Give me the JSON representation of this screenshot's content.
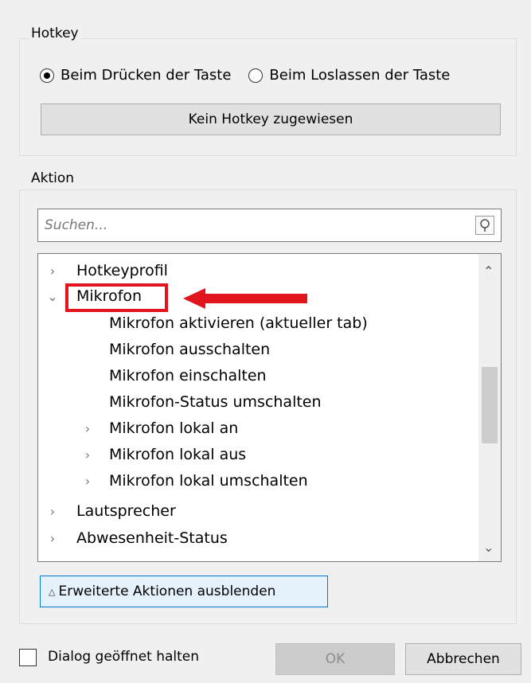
{
  "hotkey": {
    "title": "Hotkey",
    "press_label": "Beim Drücken der Taste",
    "release_label": "Beim Loslassen der Taste",
    "selected": "press",
    "button_label": "Kein Hotkey zugewiesen"
  },
  "action": {
    "title": "Aktion",
    "search_placeholder": "Suchen...",
    "tree": [
      {
        "label": "Hotkeyprofil",
        "level": 0,
        "expanded": false
      },
      {
        "label": "Mikrofon",
        "level": 0,
        "expanded": true,
        "highlighted": true
      },
      {
        "label": "Mikrofon aktivieren (aktueller tab)",
        "level": 1
      },
      {
        "label": "Mikrofon ausschalten",
        "level": 1
      },
      {
        "label": "Mikrofon einschalten",
        "level": 1
      },
      {
        "label": "Mikrofon-Status umschalten",
        "level": 1
      },
      {
        "label": "Mikrofon lokal an",
        "level": 1,
        "expandable": true
      },
      {
        "label": "Mikrofon lokal aus",
        "level": 1,
        "expandable": true
      },
      {
        "label": "Mikrofon lokal umschalten",
        "level": 1,
        "expandable": true
      },
      {
        "label": "Lautsprecher",
        "level": 0,
        "expanded": false
      },
      {
        "label": "Abwesenheit-Status",
        "level": 0,
        "expanded": false
      }
    ],
    "advanced_button_label": "Erweiterte Aktionen ausblenden"
  },
  "footer": {
    "keep_open_label": "Dialog geöffnet halten",
    "keep_open_checked": false,
    "ok_label": "OK",
    "cancel_label": "Abbrechen"
  },
  "colors": {
    "annotation_red": "#e2151c",
    "focus_blue": "#0078d7"
  },
  "icons": {
    "radio_checked": "radio-checked-icon",
    "radio_unchecked": "radio-unchecked-icon",
    "search": "search-icon",
    "chevron_right": "chevron-right-icon",
    "chevron_down": "chevron-down-icon",
    "scroll_up": "scroll-up-icon",
    "scroll_down": "scroll-down-icon",
    "advanced": "triangle-up-icon",
    "annotation_arrow": "red-arrow-icon"
  }
}
